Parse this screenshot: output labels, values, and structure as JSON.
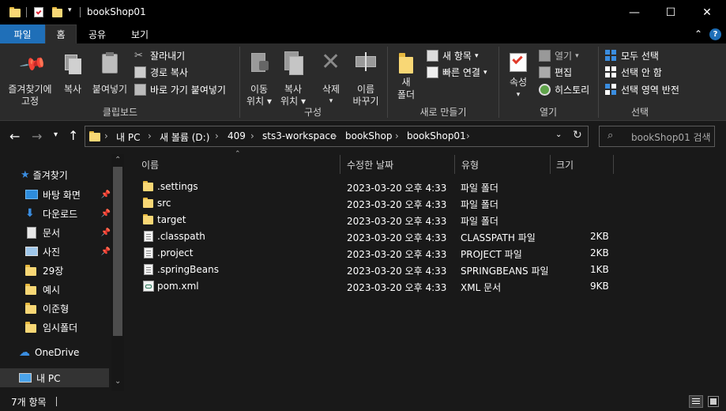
{
  "window": {
    "title": "bookShop01",
    "min_label": "—",
    "max_label": "☐",
    "close_label": "✕"
  },
  "ribbon_tabs": [
    "파일",
    "홈",
    "공유",
    "보기"
  ],
  "ribbon": {
    "clipboard": {
      "pin_label_1": "즐겨찾기에",
      "pin_label_2": "고정",
      "copy_label": "복사",
      "paste_label": "붙여넣기",
      "cut_label": "잘라내기",
      "copy_path_label": "경로 복사",
      "paste_shortcut_label": "바로 가기 붙여넣기",
      "group_name": "클립보드"
    },
    "organize": {
      "move_label_1": "이동",
      "move_label_2": "위치",
      "copyto_label_1": "복사",
      "copyto_label_2": "위치",
      "delete_label": "삭제",
      "rename_label_1": "이름",
      "rename_label_2": "바꾸기",
      "group_name": "구성"
    },
    "new": {
      "new_folder_label_1": "새",
      "new_folder_label_2": "폴더",
      "new_item_label": "새 항목",
      "easy_access_label": "빠른 연결",
      "group_name": "새로 만들기"
    },
    "open": {
      "properties_label": "속성",
      "open_label": "열기",
      "edit_label": "편집",
      "history_label": "히스토리",
      "group_name": "열기"
    },
    "select": {
      "select_all_label": "모두 선택",
      "select_none_label": "선택 안 함",
      "invert_label": "선택 영역 반전",
      "group_name": "선택"
    }
  },
  "address": {
    "crumbs": [
      "내 PC",
      "새 볼륨 (D:)",
      "409",
      "sts3-workspace",
      "bookShop",
      "bookShop01"
    ],
    "search_placeholder": "bookShop01 검색"
  },
  "nav": {
    "quick_access": "즐겨찾기",
    "items": [
      "바탕 화면",
      "다운로드",
      "문서",
      "사진",
      "29장",
      "예시",
      "이준형",
      "임시폴더"
    ],
    "onedrive": "OneDrive",
    "this_pc": "내 PC"
  },
  "columns": {
    "name": "이름",
    "modified": "수정한 날짜",
    "type": "유형",
    "size": "크기"
  },
  "files": [
    {
      "name": ".settings",
      "modified": "2023-03-20 오후 4:33",
      "type": "파일 폴더",
      "size": "",
      "icon": "folder-icon"
    },
    {
      "name": "src",
      "modified": "2023-03-20 오후 4:33",
      "type": "파일 폴더",
      "size": "",
      "icon": "folder-icon"
    },
    {
      "name": "target",
      "modified": "2023-03-20 오후 4:33",
      "type": "파일 폴더",
      "size": "",
      "icon": "folder-icon"
    },
    {
      "name": ".classpath",
      "modified": "2023-03-20 오후 4:33",
      "type": "CLASSPATH 파일",
      "size": "2KB",
      "icon": "file-icon"
    },
    {
      "name": ".project",
      "modified": "2023-03-20 오후 4:33",
      "type": "PROJECT 파일",
      "size": "2KB",
      "icon": "file-icon"
    },
    {
      "name": ".springBeans",
      "modified": "2023-03-20 오후 4:33",
      "type": "SPRINGBEANS 파일",
      "size": "1KB",
      "icon": "file-icon"
    },
    {
      "name": "pom.xml",
      "modified": "2023-03-20 오후 4:33",
      "type": "XML 문서",
      "size": "9KB",
      "icon": "xml-file-icon"
    }
  ],
  "status": {
    "count": "7개 항목"
  },
  "colors": {
    "accent": "#1f6fb8",
    "folder": "#f8d775",
    "background": "#191919"
  }
}
